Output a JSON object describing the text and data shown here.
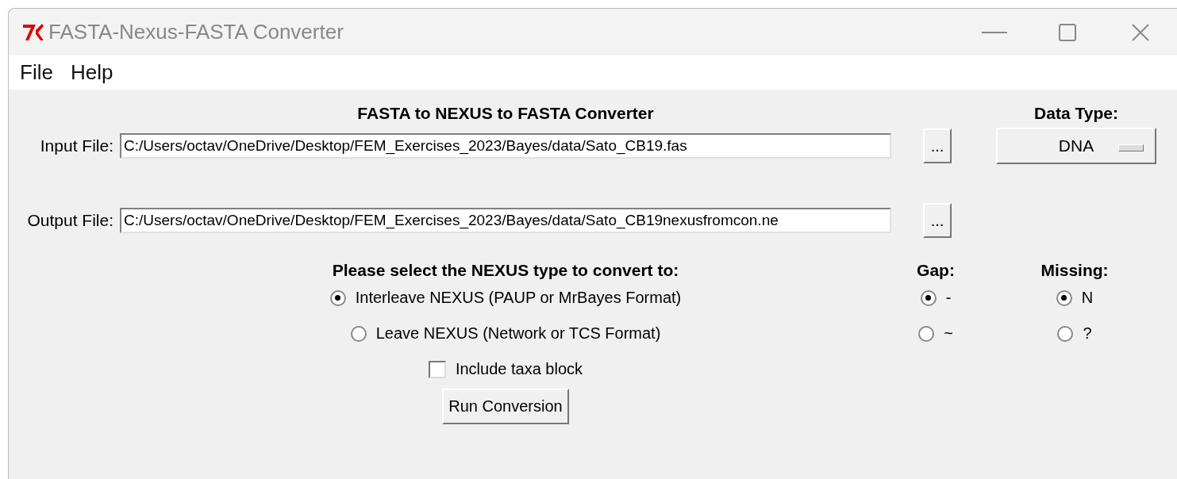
{
  "window": {
    "title": "FASTA-Nexus-FASTA Converter"
  },
  "menu": [
    "File",
    "Help"
  ],
  "heading": "FASTA to NEXUS to FASTA Converter",
  "data_type": {
    "label": "Data Type:",
    "value": "DNA"
  },
  "files": [
    {
      "label": "Input File:",
      "value": "C:/Users/octav/OneDrive/Desktop/FEM_Exercises_2023/Bayes/data/Sato_CB19.fas",
      "browse": "..."
    },
    {
      "label": "Output File:",
      "value": "C:/Users/octav/OneDrive/Desktop/FEM_Exercises_2023/Bayes/data/Sato_CB19nexusfromcon.ne",
      "browse": "..."
    }
  ],
  "nexus": {
    "heading": "Please select the NEXUS type to convert to:",
    "options": [
      {
        "label": "Interleave NEXUS (PAUP or MrBayes Format)",
        "selected": true
      },
      {
        "label": "Leave NEXUS (Network or TCS Format)",
        "selected": false
      }
    ],
    "include_taxa": {
      "label": "Include taxa block",
      "checked": false
    },
    "run_button": "Run Conversion"
  },
  "gap": {
    "heading": "Gap:",
    "options": [
      {
        "label": "-",
        "selected": true
      },
      {
        "label": "~",
        "selected": false
      }
    ]
  },
  "missing": {
    "heading": "Missing:",
    "options": [
      {
        "label": "N",
        "selected": true
      },
      {
        "label": "?",
        "selected": false
      }
    ]
  }
}
